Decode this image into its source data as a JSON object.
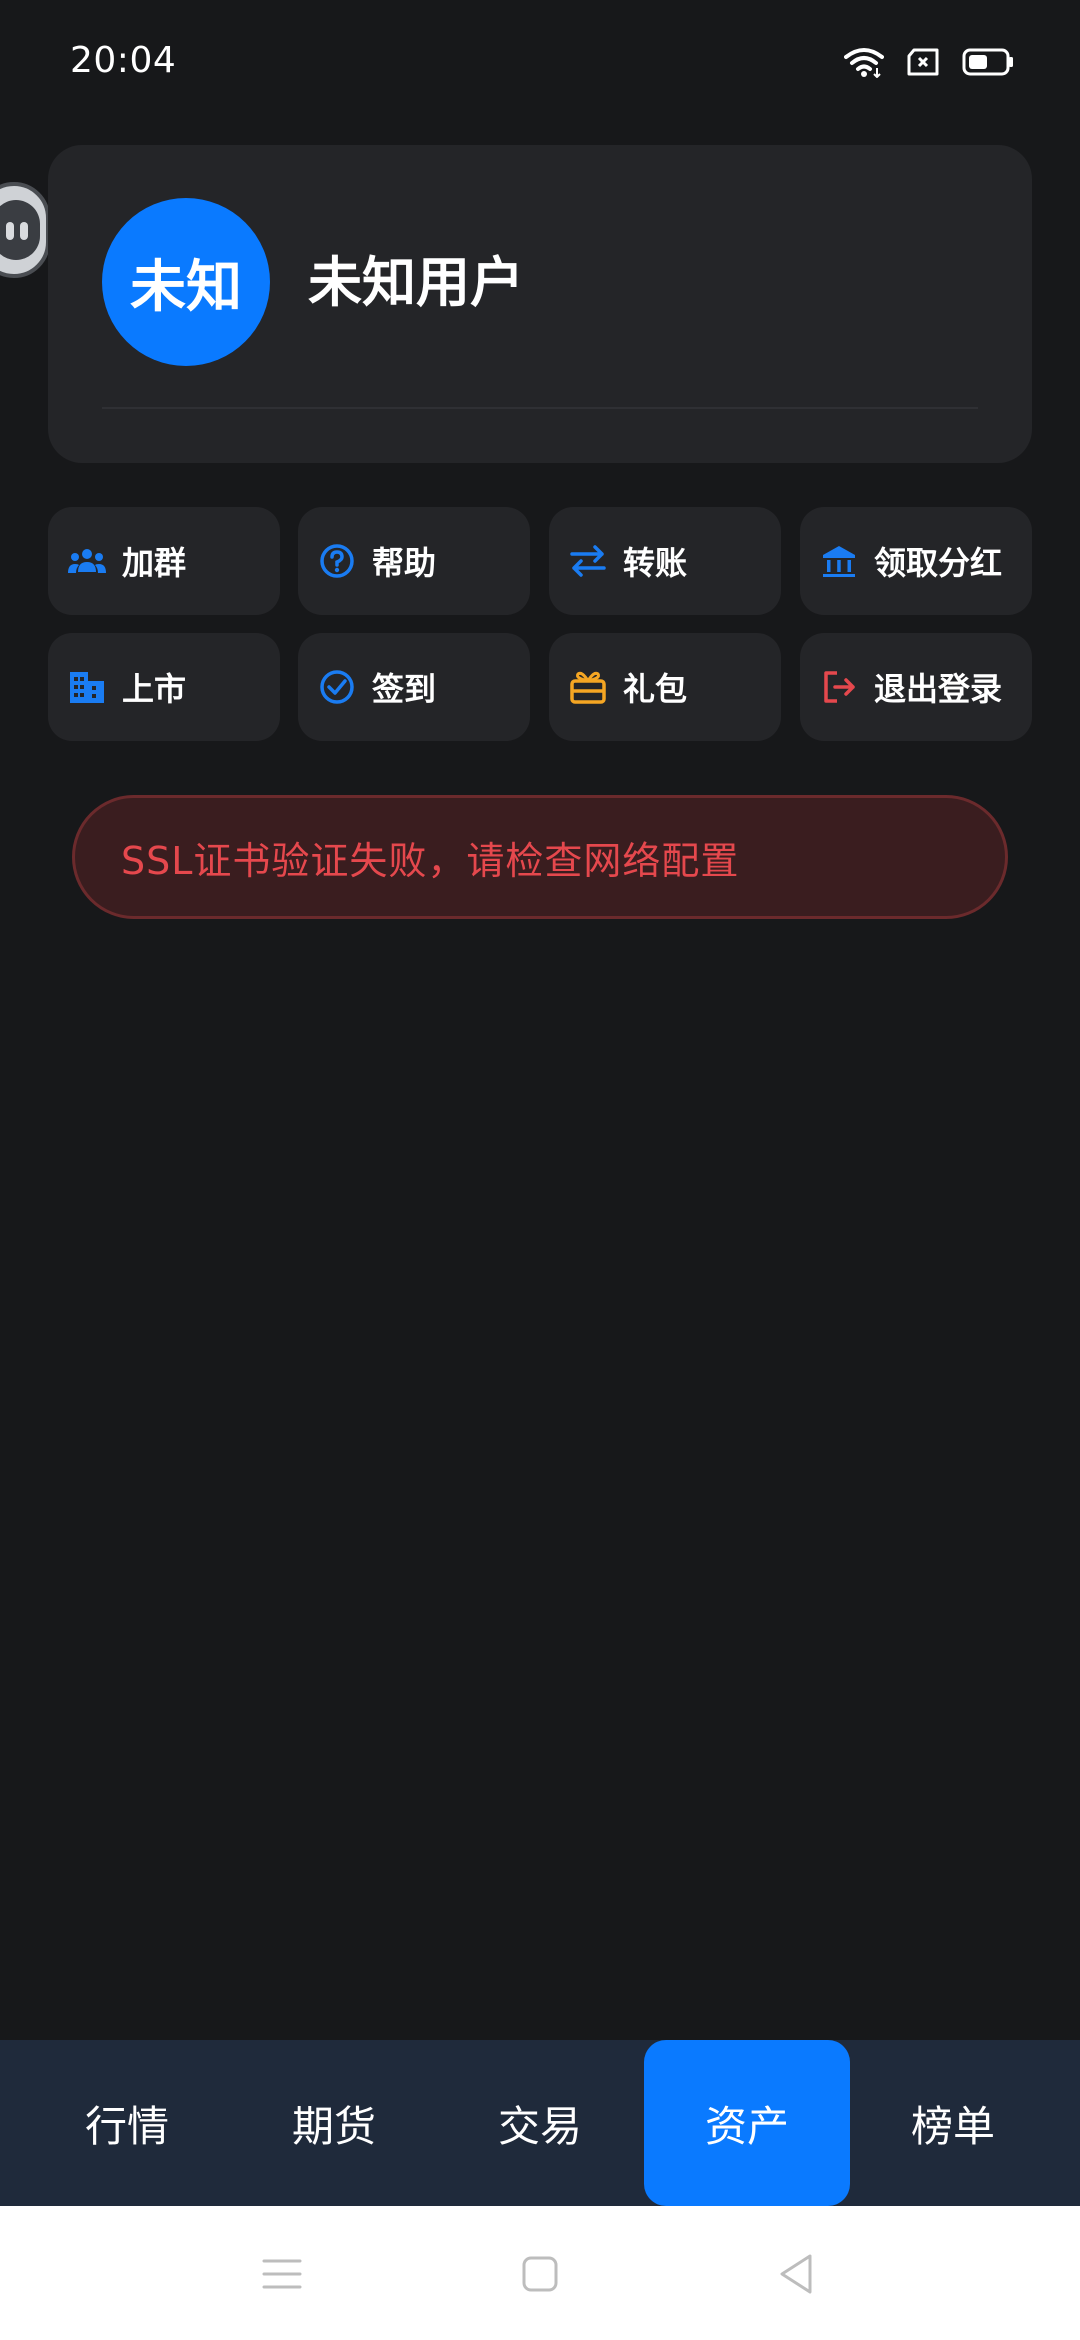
{
  "status_bar": {
    "time": "20:04",
    "icons": [
      "wifi-icon",
      "sim-error-icon",
      "battery-icon"
    ]
  },
  "profile": {
    "avatar_text": "未知",
    "username": "未知用户",
    "avatar_color": "#0a7aff"
  },
  "actions": [
    {
      "label": "加群",
      "icon": "group-icon",
      "icon_color": "#1a7cf2"
    },
    {
      "label": "帮助",
      "icon": "help-icon",
      "icon_color": "#1a7cf2"
    },
    {
      "label": "转账",
      "icon": "transfer-icon",
      "icon_color": "#1a7cf2"
    },
    {
      "label": "领取分红",
      "icon": "bank-icon",
      "icon_color": "#1a7cf2"
    },
    {
      "label": "上市",
      "icon": "building-icon",
      "icon_color": "#1a7cf2"
    },
    {
      "label": "签到",
      "icon": "check-circle-icon",
      "icon_color": "#1a7cf2"
    },
    {
      "label": "礼包",
      "icon": "gift-icon",
      "icon_color": "#f5a623"
    },
    {
      "label": "退出登录",
      "icon": "logout-icon",
      "icon_color": "#e5484d"
    }
  ],
  "error_banner": {
    "message": "SSL证书验证失败，请检查网络配置",
    "text_color": "#e5484d"
  },
  "bottom_tabs": [
    {
      "label": "行情",
      "active": false
    },
    {
      "label": "期货",
      "active": false
    },
    {
      "label": "交易",
      "active": false
    },
    {
      "label": "资产",
      "active": true
    },
    {
      "label": "榜单",
      "active": false
    }
  ],
  "system_nav": [
    "menu-icon",
    "home-icon",
    "back-icon"
  ],
  "colors": {
    "background": "#17181a",
    "card": "#242528",
    "tab_bar": "#1f2a3b",
    "accent": "#0a7aff"
  }
}
